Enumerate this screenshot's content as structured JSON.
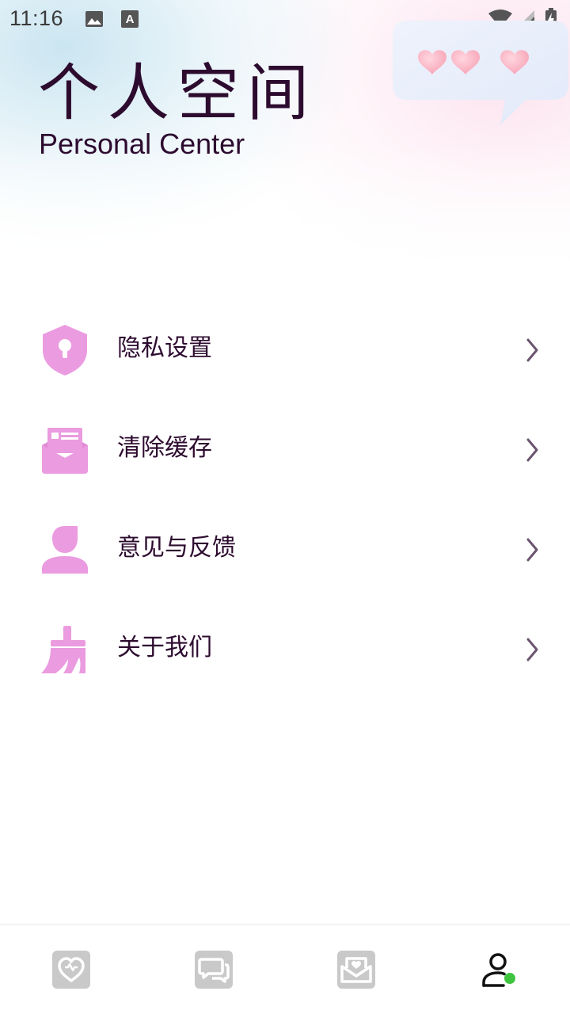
{
  "status_bar": {
    "time": "11:16",
    "left_icons": [
      "image-icon",
      "font-a-icon"
    ],
    "right_icons": [
      "wifi-icon",
      "cellular-signal-icon",
      "battery-charging-icon"
    ]
  },
  "header": {
    "title_cn": "个人空间",
    "title_en": "Personal Center",
    "decoration": "chat-bubble-hearts-icon"
  },
  "menu": {
    "items": [
      {
        "label": "隐私设置",
        "icon": "shield-lock-icon"
      },
      {
        "label": "清除缓存",
        "icon": "envelope-icon"
      },
      {
        "label": "意见与反馈",
        "icon": "user-icon"
      },
      {
        "label": "关于我们",
        "icon": "broom-icon"
      }
    ],
    "chevron_icon": "chevron-right-icon"
  },
  "tab_bar": {
    "tabs": [
      {
        "icon": "heart-tab-icon",
        "active": false
      },
      {
        "icon": "chat-tab-icon",
        "active": false
      },
      {
        "icon": "mail-tab-icon",
        "active": false
      },
      {
        "icon": "profile-tab-icon",
        "active": true
      }
    ]
  },
  "colors": {
    "accent_pink": "#eb9be0",
    "title_dark": "#2d0b2f",
    "chevron": "#6b5570",
    "tab_inactive": "#c9c9c9",
    "active_dot": "#3fc43f"
  }
}
